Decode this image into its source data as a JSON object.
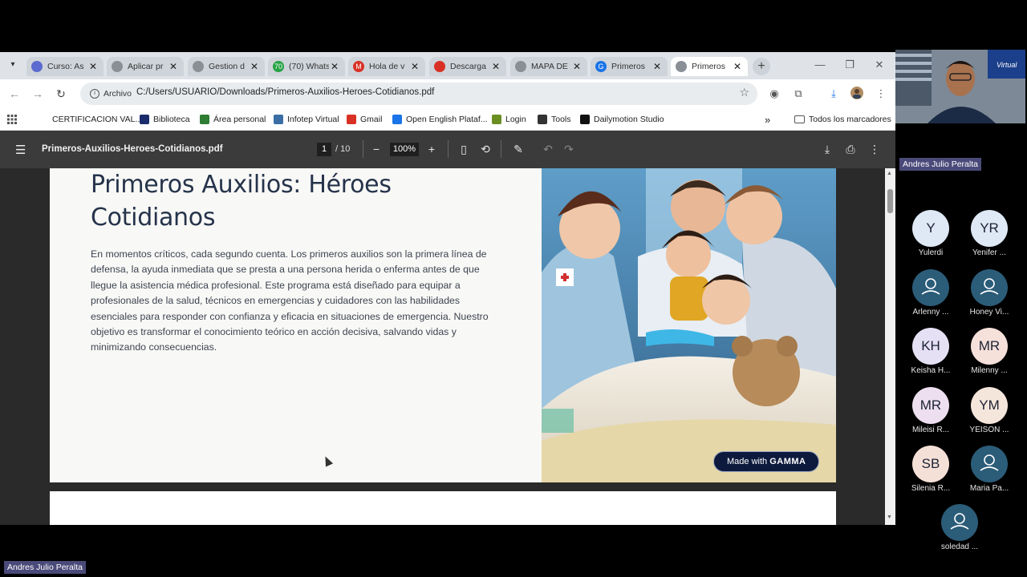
{
  "tabs": [
    {
      "label": "Curso: As",
      "favicon_color": "#5b6bd0"
    },
    {
      "label": "Aplicar pr",
      "favicon_color": "#8a8f96"
    },
    {
      "label": "Gestion d",
      "favicon_color": "#8a8f96"
    },
    {
      "label": "(70) Whats",
      "favicon_color": "#25a244",
      "favicon_text": "70"
    },
    {
      "label": "Hola de v",
      "favicon_color": "#d93025",
      "favicon_text": "M"
    },
    {
      "label": "Descarga",
      "favicon_color": "#d93025"
    },
    {
      "label": "MAPA DE",
      "favicon_color": "#8a8f96"
    },
    {
      "label": "Primeros",
      "favicon_color": "#1a73e8",
      "favicon_text": "G"
    },
    {
      "label": "Primeros",
      "favicon_color": "#8a8f96",
      "active": true
    }
  ],
  "address_bar": {
    "chip_label": "Archivo",
    "url": "C:/Users/USUARIO/Downloads/Primeros-Auxilios-Heroes-Cotidianos.pdf"
  },
  "bookmarks": [
    {
      "label": "CERTIFICACION VAL...",
      "icon": "none"
    },
    {
      "label": "Biblioteca",
      "icon": "shield-icon",
      "color": "#1a2c6b"
    },
    {
      "label": "Área personal",
      "icon": "tree-icon",
      "color": "#2e7d32"
    },
    {
      "label": "Infotep Virtual",
      "icon": "wave-icon",
      "color": "#3a6ea5"
    },
    {
      "label": "Gmail",
      "icon": "gmail-icon",
      "color": "#d93025"
    },
    {
      "label": "Open English Plataf...",
      "icon": "square-icon",
      "color": "#1a73e8"
    },
    {
      "label": "Login",
      "icon": "leaf-icon",
      "color": "#6b8e23"
    },
    {
      "label": "Tools",
      "icon": "globe-icon",
      "color": "#333333"
    },
    {
      "label": "Dailymotion Studio",
      "icon": "dailymotion-icon",
      "color": "#111111"
    }
  ],
  "bookmarks_overflow": "»",
  "all_bookmarks_label": "Todos los marcadores",
  "pdf": {
    "filename": "Primeros-Auxilios-Heroes-Cotidianos.pdf",
    "current_page": "1",
    "total_pages": "/ 10",
    "zoom": "100%"
  },
  "document": {
    "title": "Primeros Auxilios: Héroes Cotidianos",
    "body": "En momentos críticos, cada segundo cuenta. Los primeros auxilios son la primera línea de defensa, la ayuda inmediata que se presta a una persona herida o enferma antes de que llegue la asistencia médica profesional. Este programa está diseñado para equipar a profesionales de la salud, técnicos en emergencias y cuidadores con las habilidades esenciales para responder con confianza y eficacia en situaciones de emergencia. Nuestro objetivo es transformar el conocimiento teórico en acción decisiva, salvando vidas y minimizando consecuencias.",
    "badge_prefix": "Made with",
    "badge_brand": "GAMMA"
  },
  "meeting": {
    "speaker_name": "Andres Julio Peralta",
    "bottom_name": "Andres Julio Peralta",
    "participants": [
      {
        "initials": "Y",
        "name": "Yulerdi",
        "color": "#dfe8f5"
      },
      {
        "initials": "YR",
        "name": "Yenifer ...",
        "color": "#dfe8f5"
      },
      {
        "initials": "",
        "name": "Arlenny ...",
        "color": "#2b5c78"
      },
      {
        "initials": "",
        "name": "Honey Vi...",
        "color": "#2b5c78"
      },
      {
        "initials": "KH",
        "name": "Keisha H...",
        "color": "#e6e0f5"
      },
      {
        "initials": "MR",
        "name": "Milenny ...",
        "color": "#f6e0da"
      },
      {
        "initials": "MR",
        "name": "Mileisi R...",
        "color": "#eedff0"
      },
      {
        "initials": "YM",
        "name": "YEISON ...",
        "color": "#f5e6dc"
      },
      {
        "initials": "SB",
        "name": "Silenia R...",
        "color": "#f5e0d8"
      },
      {
        "initials": "",
        "name": "Maria Pa...",
        "color": "#2b5c78"
      },
      {
        "initials": "",
        "name": "soledad ...",
        "color": "#2b5c78"
      }
    ]
  }
}
